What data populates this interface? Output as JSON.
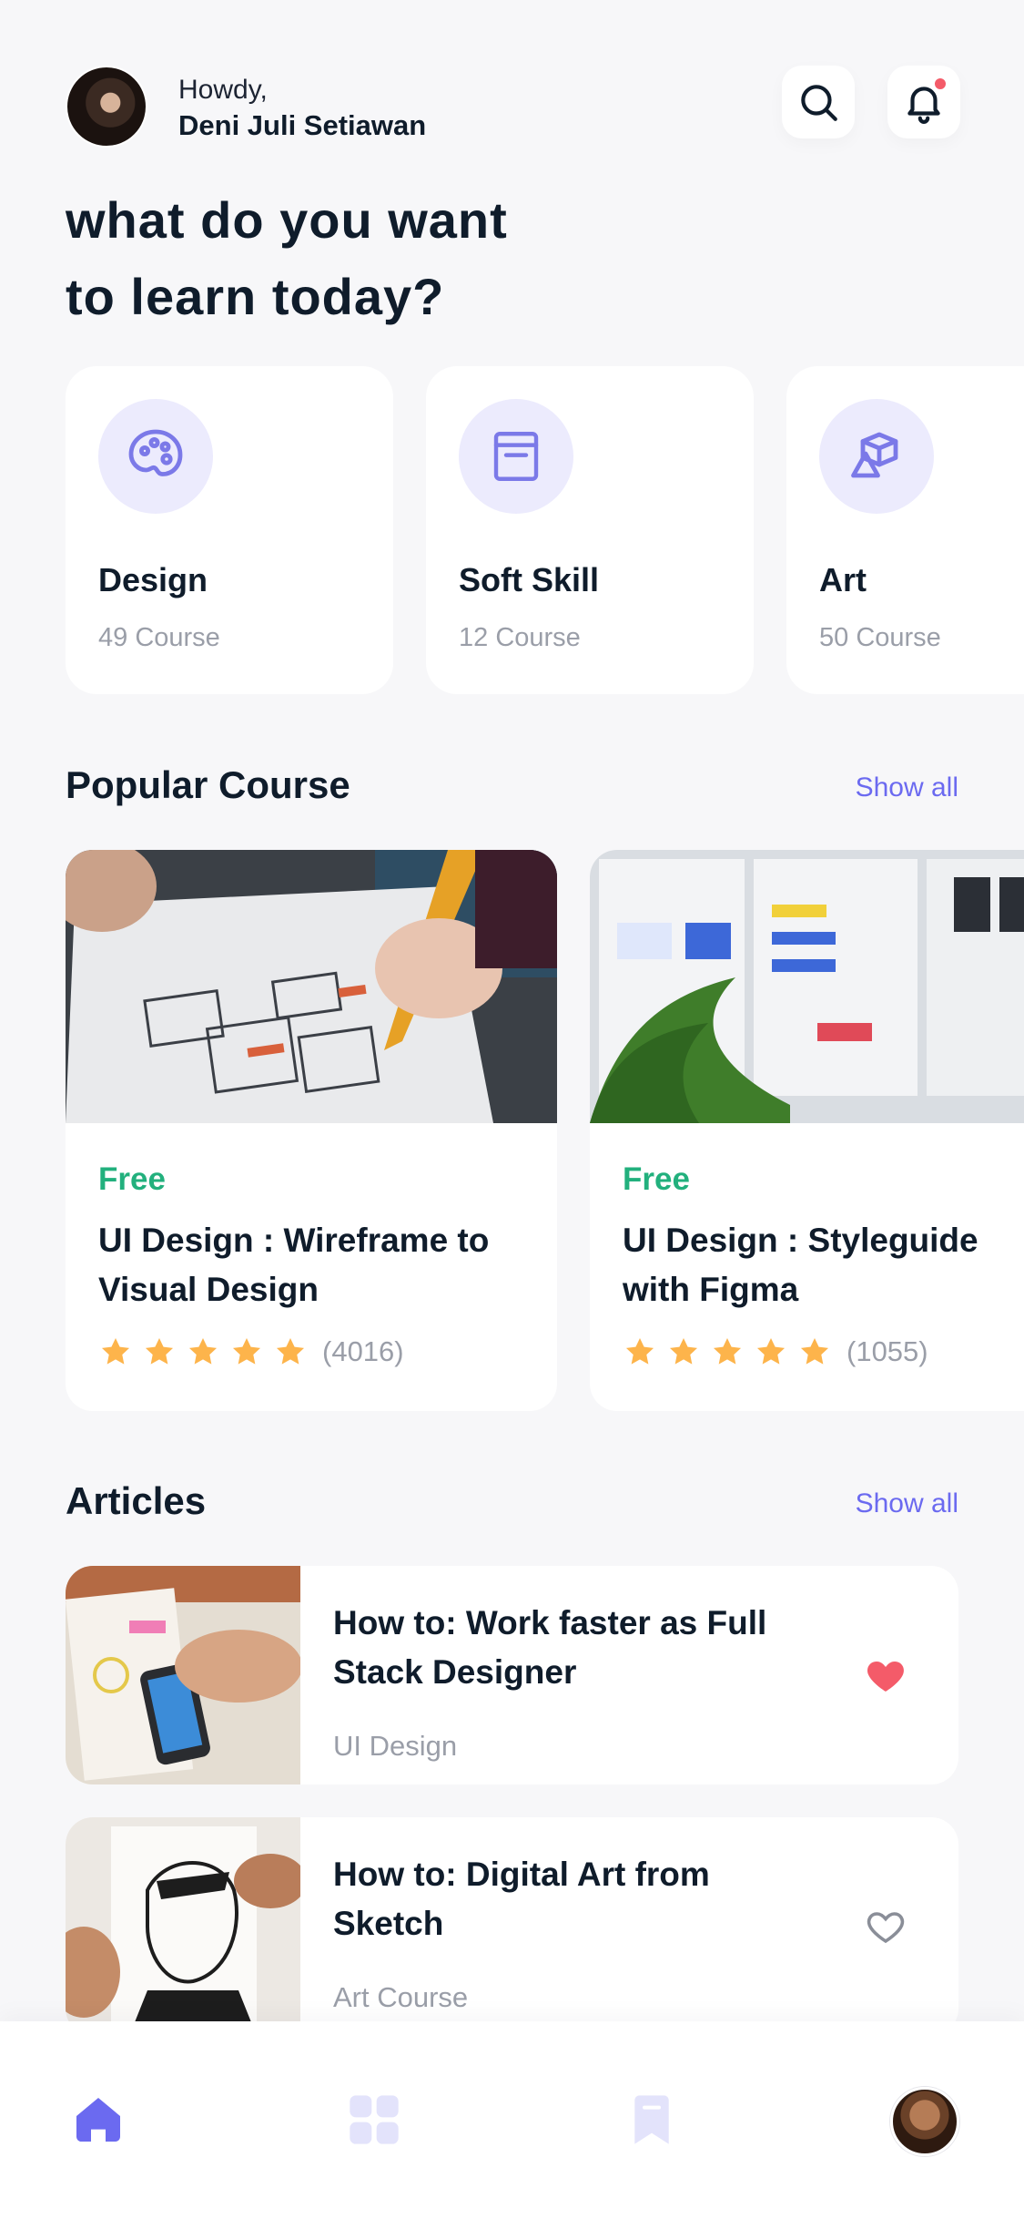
{
  "header": {
    "greeting": "Howdy,",
    "user_name": "Deni Juli Setiawan",
    "search_icon": "search-icon",
    "notification_icon": "bell-icon"
  },
  "headline": {
    "line1": "what do you want",
    "line2": "to learn today?"
  },
  "categories": [
    {
      "title": "Design",
      "count": "49 Course",
      "icon": "palette-icon"
    },
    {
      "title": "Soft Skill",
      "count": "12 Course",
      "icon": "book-icon"
    },
    {
      "title": "Art",
      "count": "50 Course",
      "icon": "shapes-icon"
    }
  ],
  "popular": {
    "title": "Popular Course",
    "show_all": "Show all",
    "courses": [
      {
        "price": "Free",
        "title": "UI Design : Wireframe to Visual Design",
        "stars": 5,
        "reviews": "(4016)"
      },
      {
        "price": "Free",
        "title": "UI Design : Styleguide with Figma",
        "stars": 5,
        "reviews": "(1055)"
      }
    ]
  },
  "articles": {
    "title": "Articles",
    "show_all": "Show all",
    "items": [
      {
        "title": "How to: Work faster as Full Stack Designer",
        "category": "UI Design",
        "liked": true
      },
      {
        "title": "How to: Digital Art from Sketch",
        "category": "Art Course",
        "liked": false
      }
    ]
  },
  "colors": {
    "accent": "#6B6AF0",
    "free": "#22B07D",
    "star": "#FDB44B",
    "heart": "#F45B69",
    "background": "#F7F7F9"
  },
  "tabs": [
    "home-icon",
    "grid-icon",
    "bookmark-icon",
    "profile-avatar"
  ]
}
